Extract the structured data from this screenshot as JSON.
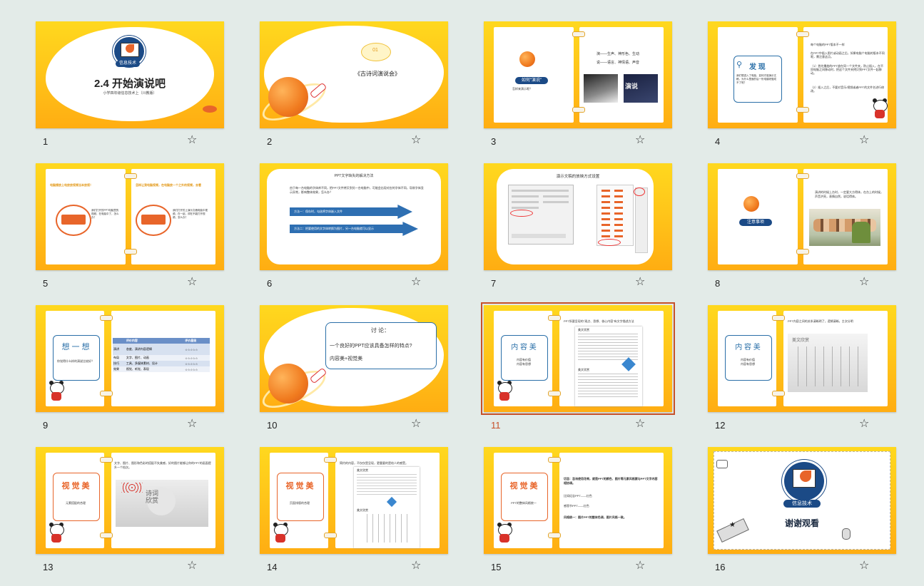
{
  "slides": [
    {
      "number": "1",
      "title": "2.4 开始演说吧",
      "subtitle": "小学四年级信息技术上（川教版）",
      "logo_text": "信息技术"
    },
    {
      "number": "2",
      "bubble_num": "01",
      "title": "《古诗词演说会》"
    },
    {
      "number": "3",
      "badge": "如何\"演说\"",
      "sub": "怎样来演示呢？",
      "line1": "演——生声、神形色、生动",
      "line2": "说——语言、神情语、声音",
      "photo2": "演说"
    },
    {
      "number": "4",
      "heading": "发 现",
      "box_text": "我们想进入了电脑，如何才能演示文稿，为什么里面的后一份电脑呢做成不了呢？",
      "p1": "每个电脑的PPT版本不一样",
      "p2": "在PPT中插入图片或动画之后，如果电脑个电脑的版本不同呢，需注意这点。",
      "p3": "（1）首先播放的PPT放在同一个文件夹，防止插入，在不同电脑之间移动时，把这个文件夹拷贝到PPT文件一起移动。",
      "p4": "（2）插入之后，不要对音乐/视频或者PPT的文件名进行修改。"
    },
    {
      "number": "5",
      "left_title": "电脑播放上电放放视频当本放视！",
      "left_text": "我们打开的PPT电脑里的视频，在电脑中了，怎么办？",
      "right_title": "怎样让我电脑视频，在电脑放一个之外的视频，去看",
      "right_text": "我们打开的上演示文稿电脑中视频，在一起，却在不能打开视频，怎么办？"
    },
    {
      "number": "6",
      "title": "PPT文字缺失的解决方法",
      "para": "由于每一台电脑的字体库不同，把PPT文件拷贝到另一台电脑中，可能会出现对应的字体不同，导致字体显示异常，影响整体效果，怎么办？",
      "arrow1": "方法一：保存时，勾选将字体嵌入文件",
      "arrow2": "方法二：把要使用的文字体转换为图片，另一台电脑就可以显示"
    },
    {
      "number": "7",
      "title": "演示文稿的放映方式设置"
    },
    {
      "number": "8",
      "badge": "注意事项",
      "text": "演讲的时候上台时，一定要大方得体，在台上的时候，声音洪亮，表情自然，说话得体。"
    },
    {
      "number": "9",
      "box_title": "想 一 想",
      "box_text": "你觉得什么样的演说比较好？",
      "table_headers": [
        "",
        "评价内容",
        "评价星级"
      ],
      "table_rows": [
        [
          "演讲",
          "态度、演讲内容逻辑",
          "☆☆☆☆☆"
        ],
        [
          "布局",
          "文字、图片、动画",
          "☆☆☆☆☆"
        ],
        [
          "技巧",
          "工具、多媒体素材、设计",
          "☆☆☆☆☆"
        ],
        [
          "效果",
          "视觉、听觉、表现",
          "☆☆☆☆☆"
        ]
      ]
    },
    {
      "number": "10",
      "heading": "讨 论：",
      "question": "一个良好的PPT应该具备怎样的特点?",
      "answer": "内容美+视觉美"
    },
    {
      "number": "11",
      "title": "内 容 美",
      "box_text": "内容有价值\n内容有思想",
      "top_text": "PPT所要呈现的\"观点、思想、核心内容\"有文字描述方法",
      "doc_title": "美文欣赏"
    },
    {
      "number": "12",
      "title": "内 容 美",
      "box_text": "内容有价值\n内容有思想",
      "top_text": "PPT内容之间的关系清晰明了，逻辑清晰，主次分明",
      "doc_title": "美文欣赏"
    },
    {
      "number": "13",
      "title": "视 觉 美",
      "box_text": "元素搭配的合理",
      "text": "文字、图片、图形和色彩的搭配不失美感，好的图片能够让你的PPT的画面提升一个档次。",
      "painting": "诗词欣赏"
    },
    {
      "number": "14",
      "title": "视 觉 美",
      "box_text": "页面排版的合理",
      "text": "简约的内容，不仅仅是呈现，更重要的是给人的感受。",
      "doc_title": "美文欣赏"
    },
    {
      "number": "15",
      "title": "视 觉 美",
      "box_text": "PPT的整体风格统一",
      "l1": "切忌：忌讳使用花哨，就是PPT的颜色、图片等元素风格要与PPT文字内容相协调。",
      "l2": "比如纪念PPT——红色",
      "l3": "感恩节PPT——红色",
      "l4": "风格统一：图片PPT的整体色调，图片风格一致。"
    },
    {
      "number": "16",
      "logo_text": "信息技术",
      "closing": "谢谢观看"
    }
  ],
  "selected_slide": "11",
  "star_icon": "☆",
  "colors": {
    "accent": "#c6512a",
    "slide_yellow": "#ffc61a",
    "title_orange": "#e8652a",
    "blue": "#1b4a86"
  }
}
